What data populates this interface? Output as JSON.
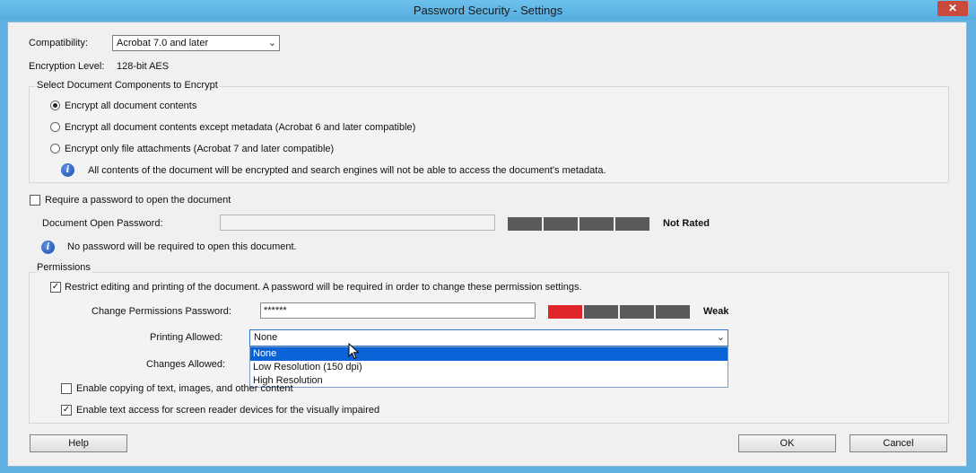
{
  "window": {
    "title": "Password Security - Settings",
    "close_glyph": "✕"
  },
  "compatibility": {
    "label": "Compatibility:",
    "value": "Acrobat 7.0 and later"
  },
  "encryption": {
    "label": "Encryption  Level:",
    "value": "128-bit AES"
  },
  "components": {
    "label": "Select Document Components to Encrypt",
    "options": [
      {
        "label": "Encrypt all document contents",
        "selected": true
      },
      {
        "label": "Encrypt all document contents except metadata (Acrobat 6 and later compatible)",
        "selected": false
      },
      {
        "label": "Encrypt only file attachments (Acrobat 7 and later compatible)",
        "selected": false
      }
    ],
    "info": "All contents of the document will be encrypted and search engines will not be able to access the document's metadata."
  },
  "open_password": {
    "require_label": "Require a password to open the document",
    "require_checked": false,
    "field_label": "Document Open Password:",
    "value": "",
    "strength": "Not Rated",
    "info": "No password will be required to open this document."
  },
  "permissions": {
    "label": "Permissions",
    "restrict_label": "Restrict editing and printing of the document. A password will be required in order to change these permission settings.",
    "restrict_checked": true,
    "change_label": "Change Permissions Password:",
    "change_value": "******",
    "strength": "Weak",
    "strength_level": 1,
    "printing_label": "Printing Allowed:",
    "printing_value": "None",
    "printing_options": [
      "None",
      "Low Resolution (150 dpi)",
      "High Resolution"
    ],
    "changes_label": "Changes Allowed:",
    "copy_label": "Enable copying of text, images, and other content",
    "copy_checked": false,
    "screen_reader_label": "Enable text access for screen reader devices for the visually impaired",
    "screen_reader_checked": true
  },
  "buttons": {
    "help": "Help",
    "ok": "OK",
    "cancel": "Cancel"
  },
  "colors": {
    "meter_weak": "#e0262a",
    "meter_empty": "#5a5a5a",
    "selection": "#0a64d8",
    "titlebar": "#5fb0e0"
  }
}
